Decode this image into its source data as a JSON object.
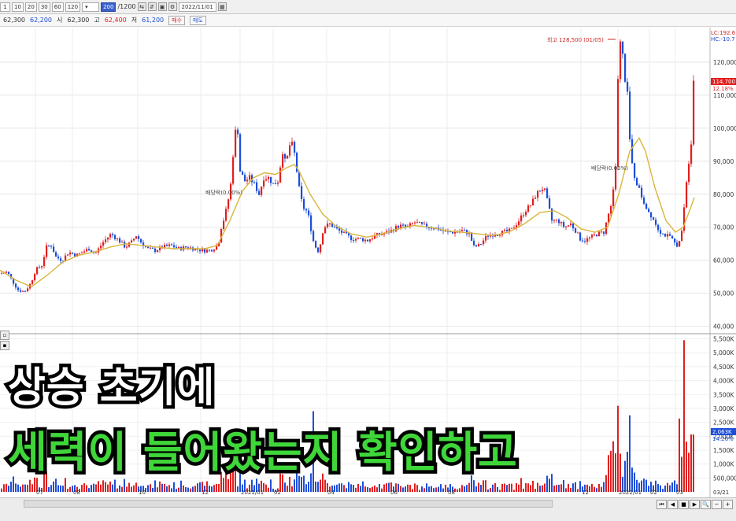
{
  "toolbar": {
    "period_buttons": [
      "1",
      "10",
      "20",
      "30",
      "60",
      "120"
    ],
    "count_value": "200",
    "count_total": "/1200",
    "date_value": "2022/11/01"
  },
  "pricebar": {
    "current": "62,300",
    "change": "62,200",
    "open_label": "시",
    "open": "62,300",
    "high_label": "고",
    "high": "62,400",
    "low_label": "저",
    "low": "61,200",
    "buy_button": "매수",
    "sell_button": "매도"
  },
  "chart_data": {
    "type": "candlestick",
    "price_axis_ticks": [
      "120,000",
      "110,000",
      "100,000",
      "90,000",
      "80,000",
      "70,000",
      "60,000",
      "50,000",
      "40,000"
    ],
    "volume_axis_ticks": [
      "5,500K",
      "5,000K",
      "4,500K",
      "4,000K",
      "3,500K",
      "3,000K",
      "2,500K",
      "2,000K",
      "1,500K",
      "1,000K",
      "500,000"
    ],
    "x_axis_labels": [
      "07",
      "08",
      "10",
      "12",
      "2021/01",
      "02",
      "04",
      "06",
      "08",
      "12",
      "2022/01",
      "02",
      "03",
      "03/21"
    ],
    "corner_labels": [
      "LC:192.6",
      "HC:-10.7"
    ],
    "current_price_tag": "114,700",
    "current_price_sub": "12.18%",
    "current_volume_tag": "2,063K",
    "current_volume_sub": "14.26%",
    "annotations": {
      "high": "최고 128,500 (01/05)",
      "dividend1": "배당락(0.00%)",
      "dividend2": "배당락(0.00%)"
    },
    "ylim": [
      38000,
      130000
    ],
    "close_path": [
      [
        0,
        56000
      ],
      [
        8,
        56500
      ],
      [
        14,
        54000
      ],
      [
        22,
        51000
      ],
      [
        30,
        50500
      ],
      [
        38,
        53000
      ],
      [
        44,
        57000
      ],
      [
        52,
        58500
      ],
      [
        58,
        64000
      ],
      [
        64,
        64500
      ],
      [
        70,
        61000
      ],
      [
        78,
        60000
      ],
      [
        86,
        62500
      ],
      [
        96,
        61500
      ],
      [
        104,
        62500
      ],
      [
        112,
        63500
      ],
      [
        120,
        62000
      ],
      [
        130,
        65500
      ],
      [
        140,
        68000
      ],
      [
        150,
        66000
      ],
      [
        158,
        64000
      ],
      [
        166,
        65500
      ],
      [
        172,
        67500
      ],
      [
        178,
        65500
      ],
      [
        186,
        63500
      ],
      [
        196,
        63000
      ],
      [
        206,
        64000
      ],
      [
        216,
        64500
      ],
      [
        226,
        63500
      ],
      [
        236,
        64000
      ],
      [
        246,
        63500
      ],
      [
        256,
        63000
      ],
      [
        266,
        63000
      ],
      [
        276,
        64500
      ],
      [
        280,
        70000
      ],
      [
        284,
        73000
      ],
      [
        288,
        77000
      ],
      [
        292,
        83000
      ],
      [
        296,
        95000
      ],
      [
        300,
        103000
      ],
      [
        304,
        87000
      ],
      [
        310,
        84000
      ],
      [
        316,
        85000
      ],
      [
        322,
        83000
      ],
      [
        328,
        80000
      ],
      [
        334,
        85000
      ],
      [
        340,
        85000
      ],
      [
        346,
        83000
      ],
      [
        352,
        84000
      ],
      [
        358,
        93000
      ],
      [
        362,
        89000
      ],
      [
        368,
        96000
      ],
      [
        372,
        94000
      ],
      [
        376,
        87000
      ],
      [
        380,
        80000
      ],
      [
        384,
        76000
      ],
      [
        388,
        75000
      ],
      [
        392,
        72500
      ],
      [
        396,
        66500
      ],
      [
        400,
        64000
      ],
      [
        404,
        62500
      ],
      [
        410,
        70000
      ],
      [
        418,
        71000
      ],
      [
        426,
        69500
      ],
      [
        436,
        68000
      ],
      [
        446,
        66500
      ],
      [
        456,
        66500
      ],
      [
        466,
        66000
      ],
      [
        476,
        67500
      ],
      [
        486,
        68000
      ],
      [
        496,
        69000
      ],
      [
        506,
        70500
      ],
      [
        516,
        70000
      ],
      [
        526,
        71500
      ],
      [
        536,
        70500
      ],
      [
        546,
        70000
      ],
      [
        556,
        69500
      ],
      [
        566,
        68500
      ],
      [
        576,
        68500
      ],
      [
        586,
        69000
      ],
      [
        596,
        68000
      ],
      [
        600,
        64000
      ],
      [
        608,
        64500
      ],
      [
        618,
        67500
      ],
      [
        628,
        68000
      ],
      [
        638,
        68500
      ],
      [
        648,
        69000
      ],
      [
        658,
        72000
      ],
      [
        666,
        75000
      ],
      [
        674,
        77000
      ],
      [
        680,
        80000
      ],
      [
        686,
        81500
      ],
      [
        690,
        82000
      ],
      [
        694,
        78000
      ],
      [
        700,
        72000
      ],
      [
        708,
        72000
      ],
      [
        716,
        70000
      ],
      [
        724,
        71000
      ],
      [
        730,
        69000
      ],
      [
        736,
        66500
      ],
      [
        742,
        66000
      ],
      [
        750,
        67000
      ],
      [
        758,
        68000
      ],
      [
        766,
        68500
      ],
      [
        772,
        74000
      ],
      [
        776,
        78000
      ],
      [
        780,
        85000
      ],
      [
        782,
        92000
      ],
      [
        784,
        115000
      ],
      [
        786,
        123000
      ],
      [
        788,
        128000
      ],
      [
        790,
        122000
      ],
      [
        792,
        115000
      ],
      [
        796,
        110000
      ],
      [
        800,
        92000
      ],
      [
        804,
        86000
      ],
      [
        810,
        82000
      ],
      [
        816,
        78000
      ],
      [
        822,
        75000
      ],
      [
        828,
        73000
      ],
      [
        834,
        70000
      ],
      [
        840,
        68000
      ],
      [
        846,
        67500
      ],
      [
        852,
        66500
      ],
      [
        858,
        64500
      ],
      [
        862,
        65500
      ],
      [
        866,
        71000
      ],
      [
        870,
        82000
      ],
      [
        874,
        90000
      ],
      [
        878,
        98000
      ],
      [
        880,
        114700
      ]
    ],
    "ma_path": [
      [
        0,
        57000
      ],
      [
        20,
        54000
      ],
      [
        40,
        52000
      ],
      [
        60,
        55500
      ],
      [
        80,
        59500
      ],
      [
        100,
        61500
      ],
      [
        120,
        62500
      ],
      [
        140,
        64000
      ],
      [
        160,
        65000
      ],
      [
        180,
        64500
      ],
      [
        200,
        64000
      ],
      [
        220,
        63500
      ],
      [
        240,
        63500
      ],
      [
        260,
        63500
      ],
      [
        276,
        64500
      ],
      [
        292,
        72000
      ],
      [
        308,
        81000
      ],
      [
        322,
        85000
      ],
      [
        336,
        86500
      ],
      [
        350,
        86000
      ],
      [
        364,
        88000
      ],
      [
        374,
        89000
      ],
      [
        380,
        87000
      ],
      [
        394,
        80000
      ],
      [
        410,
        74000
      ],
      [
        426,
        70500
      ],
      [
        446,
        68000
      ],
      [
        466,
        67000
      ],
      [
        486,
        68000
      ],
      [
        506,
        69500
      ],
      [
        526,
        70500
      ],
      [
        546,
        70000
      ],
      [
        566,
        69000
      ],
      [
        586,
        68500
      ],
      [
        606,
        68000
      ],
      [
        626,
        67500
      ],
      [
        646,
        68500
      ],
      [
        666,
        71000
      ],
      [
        686,
        74500
      ],
      [
        704,
        75000
      ],
      [
        720,
        73000
      ],
      [
        738,
        69500
      ],
      [
        756,
        68500
      ],
      [
        772,
        70000
      ],
      [
        786,
        80000
      ],
      [
        800,
        93000
      ],
      [
        812,
        97000
      ],
      [
        820,
        93000
      ],
      [
        832,
        82000
      ],
      [
        846,
        72000
      ],
      [
        858,
        68500
      ],
      [
        868,
        70000
      ],
      [
        876,
        75000
      ],
      [
        882,
        79000
      ]
    ],
    "volume_ticks_real": [
      5500,
      5000,
      4500,
      4000,
      3500,
      3000,
      2500,
      2000,
      1500,
      1000,
      500
    ]
  },
  "caption": {
    "line1": "상승 초기에",
    "line2": "세력이 들어왔는지 확인하고"
  }
}
